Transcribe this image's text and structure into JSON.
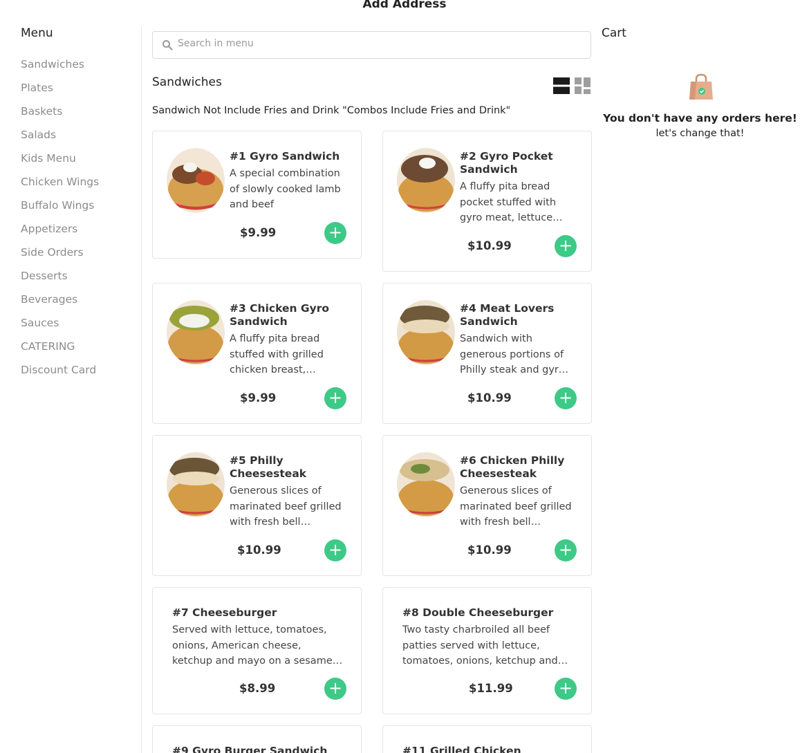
{
  "header": {
    "title": "Add Address"
  },
  "menu": {
    "title": "Menu",
    "items": [
      "Sandwiches",
      "Plates",
      "Baskets",
      "Salads",
      "Kids Menu",
      "Chicken Wings",
      "Buffalo Wings",
      "Appetizers",
      "Side Orders",
      "Desserts",
      "Beverages",
      "Sauces",
      "CATERING",
      "Discount Card"
    ]
  },
  "search": {
    "placeholder": "Search in menu"
  },
  "section": {
    "title": "Sandwiches",
    "description": "Sandwich Not Include Fries and Drink \"Combos Include Fries and Drink\""
  },
  "products": [
    {
      "name": "#1 Gyro Sandwich",
      "desc": "A special combination of slowly cooked lamb and beef",
      "price": "$9.99"
    },
    {
      "name": "#2 Gyro Pocket Sandwich",
      "desc": "A fluffy pita bread pocket stuffed with gyro meat, lettuce and tomatoes",
      "price": "$10.99"
    },
    {
      "name": "#3 Chicken Gyro Sandwich",
      "desc": "A fluffy pita bread stuffed with grilled chicken breast, lettuce and tomatoes",
      "price": "$9.99"
    },
    {
      "name": "#4 Meat Lovers Sandwich",
      "desc": "Sandwich with generous portions of Philly steak and gyro meat",
      "price": "$10.99"
    },
    {
      "name": "#5 Philly Cheesesteak",
      "desc": "Generous slices of marinated beef grilled with fresh bell peppers and onions",
      "price": "$10.99"
    },
    {
      "name": "#6 Chicken Philly Cheesesteak",
      "desc": "Generous slices of marinated beef grilled with fresh bell peppers and onions",
      "price": "$10.99"
    },
    {
      "name": "#7 Cheeseburger",
      "desc": "Served with lettuce, tomatoes, onions, American cheese, ketchup and mayo on a sesame bun",
      "price": "$8.99"
    },
    {
      "name": "#8 Double Cheeseburger",
      "desc": "Two tasty charbroiled all beef patties served with lettuce, tomatoes, onions, ketchup and mayo",
      "price": "$11.99"
    },
    {
      "name": "#9 Gyro Burger Sandwich",
      "desc": "",
      "price": ""
    },
    {
      "name": "#11 Grilled Chicken",
      "desc": "",
      "price": ""
    }
  ],
  "cart": {
    "title": "Cart",
    "empty_title": "You don't have any orders here!",
    "empty_subtitle": "let's change that!"
  },
  "colors": {
    "accent": "#3ec987",
    "muted": "#8c8c8c",
    "border": "#e4e4e4"
  },
  "icons": {
    "search": "search-icon",
    "list_view": "list-view-icon",
    "grid_view": "grid-view-icon",
    "add": "plus-icon",
    "bag": "shopping-bag-icon"
  }
}
